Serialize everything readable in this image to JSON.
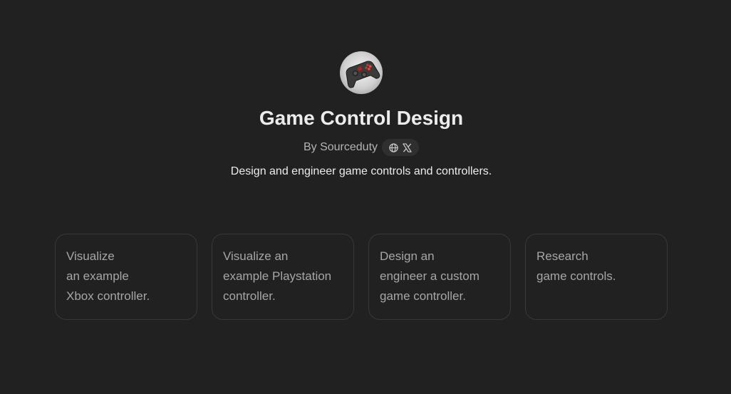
{
  "gpt": {
    "title": "Game Control Design",
    "author": "By Sourceduty",
    "description": "Design and engineer game controls and controllers."
  },
  "icons": {
    "avatar": "game-controller-image",
    "website": "globe-icon",
    "social": "x-logo-icon"
  },
  "prompts": [
    {
      "lines": [
        "Visualize",
        "an example",
        "Xbox controller."
      ]
    },
    {
      "lines": [
        "Visualize an",
        "example Playstation",
        "controller."
      ]
    },
    {
      "lines": [
        "Design an",
        "engineer a custom",
        "game controller."
      ]
    },
    {
      "lines": [
        "Research",
        "game controls."
      ]
    }
  ],
  "colors": {
    "background": "#212121",
    "card_border": "#383838",
    "card_text": "#a6a6a6",
    "title_text": "#ececec"
  }
}
